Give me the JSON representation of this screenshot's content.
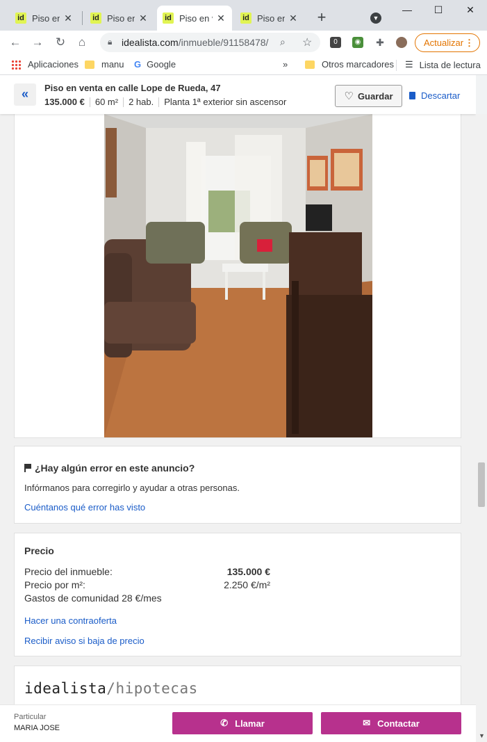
{
  "browser": {
    "tabs": [
      {
        "favicon": "id",
        "title": "Piso en v",
        "active": false
      },
      {
        "favicon": "id",
        "title": "Piso en v",
        "active": false
      },
      {
        "favicon": "id",
        "title": "Piso en v",
        "active": true
      },
      {
        "favicon": "id",
        "title": "Piso en v",
        "active": false
      }
    ],
    "url_host": "idealista.com",
    "url_path": "/inmueble/91158478/",
    "update_label": "Actualizar",
    "bookmarks": {
      "apps": "Aplicaciones",
      "manu": "manu",
      "google": "Google",
      "other": "Otros marcadores",
      "reading_list": "Lista de lectura"
    }
  },
  "header": {
    "title": "Piso en venta en calle Lope de Rueda, 47",
    "price": "135.000 €",
    "area": "60 m²",
    "rooms": "2 hab.",
    "floor": "Planta 1ª exterior sin ascensor",
    "save_label": "Guardar",
    "discard_label": "Descartar"
  },
  "error_card": {
    "heading": "¿Hay algún error en este anuncio?",
    "text": "Infórmanos para corregirlo y ayudar a otras personas.",
    "link": "Cuéntanos qué error has visto"
  },
  "price_card": {
    "heading": "Precio",
    "rows": [
      {
        "label": "Precio del inmueble:",
        "value": "135.000 €"
      },
      {
        "label": "Precio por m²:",
        "value": "2.250 €/m²"
      }
    ],
    "community": "Gastos de comunidad 28 €/mes",
    "counteroffer_link": "Hacer una contraoferta",
    "alert_link": "Recibir aviso si baja de precio"
  },
  "mortgage_card": {
    "logo_main": "idealista",
    "logo_sub": "/hipotecas"
  },
  "footer": {
    "seller_type": "Particular",
    "seller_name": "MARIA JOSE",
    "call_label": "Llamar",
    "contact_label": "Contactar"
  },
  "colors": {
    "brand_accent": "#e1f453",
    "link_blue": "#1a5cc8",
    "cta_magenta": "#b7318d",
    "update_orange": "#e37400"
  }
}
